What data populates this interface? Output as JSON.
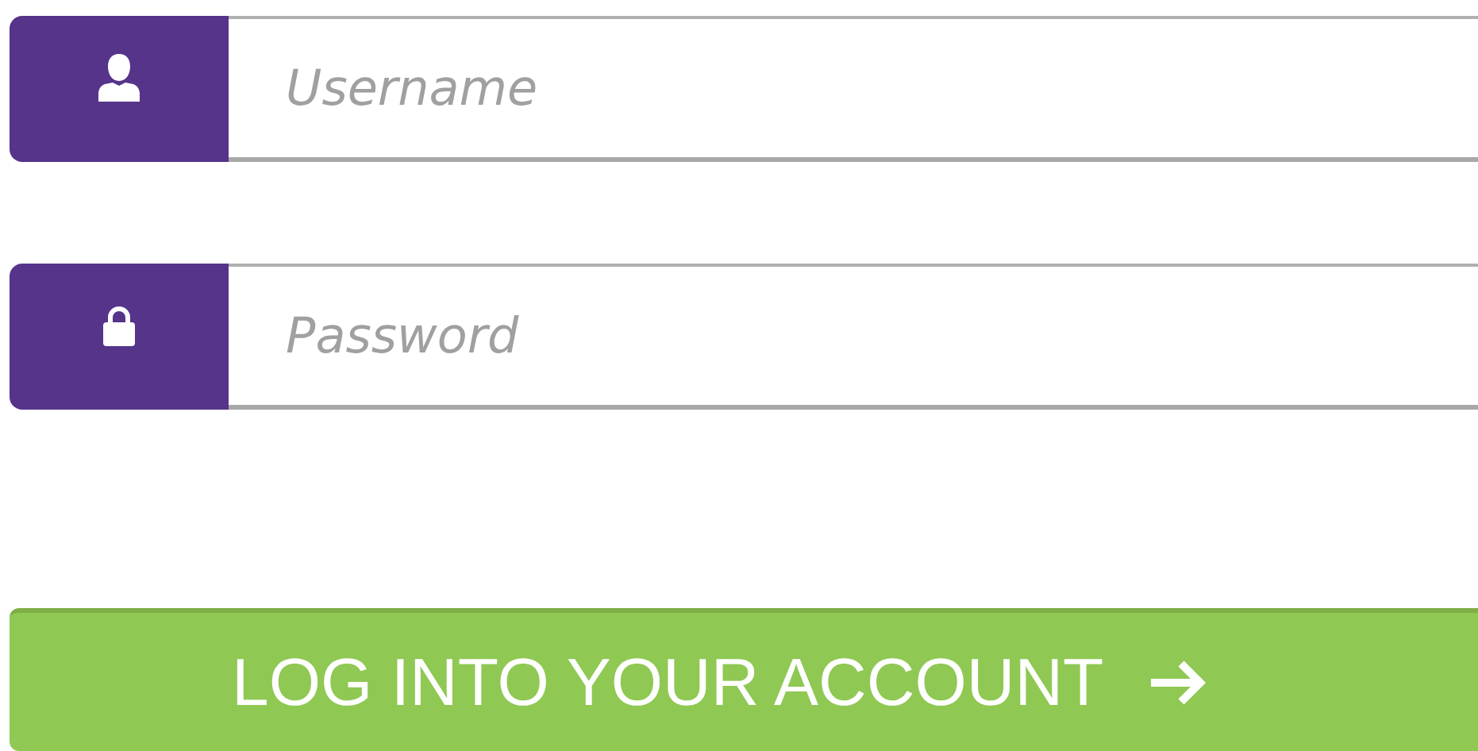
{
  "fields": [
    {
      "kind": "username",
      "placeholder": "Username"
    },
    {
      "kind": "password",
      "placeholder": "Password"
    }
  ],
  "button": {
    "label": "LOG INTO YOUR ACCOUNT"
  }
}
